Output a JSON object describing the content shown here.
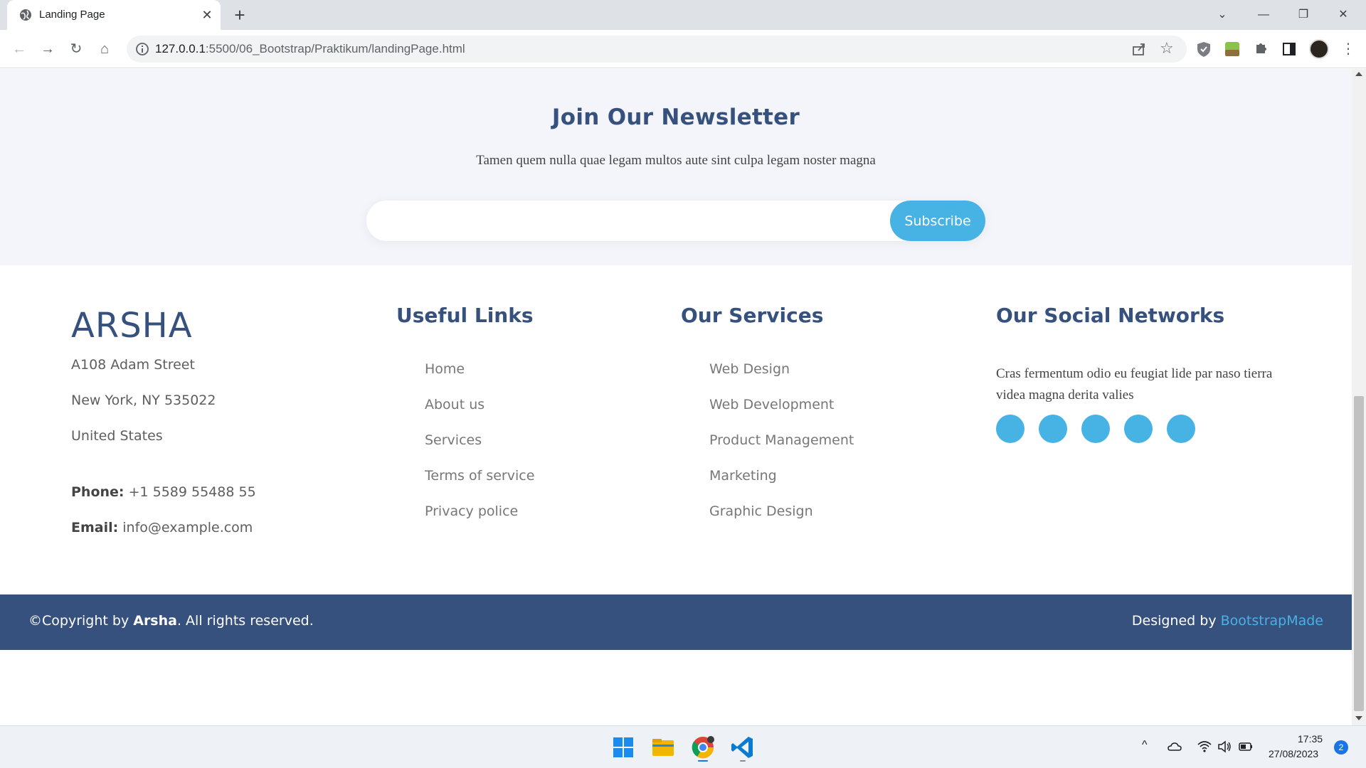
{
  "browser": {
    "tab_title": "Landing Page",
    "tab_close": "✕",
    "new_tab": "+",
    "url_host": "127.0.0.1",
    "url_path": ":5500/06_Bootstrap/Praktikum/landingPage.html",
    "win_minimize": "—",
    "win_restore": "❐",
    "win_close": "✕",
    "tab_search": "⌄",
    "back": "←",
    "forward": "→",
    "reload": "↻",
    "home": "⌂",
    "star": "☆",
    "menu": "⋮"
  },
  "newsletter": {
    "title": "Join Our Newsletter",
    "subtitle": "Tamen quem nulla quae legam multos aute sint culpa legam noster magna",
    "input_placeholder": "",
    "button_label": "Subscribe"
  },
  "footer": {
    "brand": "ARSHA",
    "address": [
      "A108 Adam Street",
      "New York, NY 535022",
      "United States"
    ],
    "phone_label": "Phone:",
    "phone_value": "+1 5589 55488 55",
    "email_label": "Email:",
    "email_value": "info@example.com",
    "useful_links_title": "Useful Links",
    "useful_links": [
      "Home",
      "About us",
      "Services",
      "Terms of service",
      "Privacy police"
    ],
    "services_title": "Our Services",
    "services": [
      "Web Design",
      "Web Development",
      "Product Management",
      "Marketing",
      "Graphic Design"
    ],
    "social_title": "Our Social Networks",
    "social_text": "Cras fermentum odio eu feugiat lide par naso tierra videa magna derita valies",
    "social_count": 5
  },
  "footer_bottom": {
    "copy_prefix": "©Copyright by ",
    "copy_brand": "Arsha",
    "copy_suffix": ". All rights reserved.",
    "credits_prefix": "Designed by ",
    "credits_link": "BootstrapMade"
  },
  "taskbar": {
    "time": "17:35",
    "date": "27/08/2023",
    "notification_count": "2",
    "chevron": "^"
  },
  "colors": {
    "primary": "#37517e",
    "accent": "#47b2e4",
    "newsletter_bg": "#f3f5fa"
  }
}
